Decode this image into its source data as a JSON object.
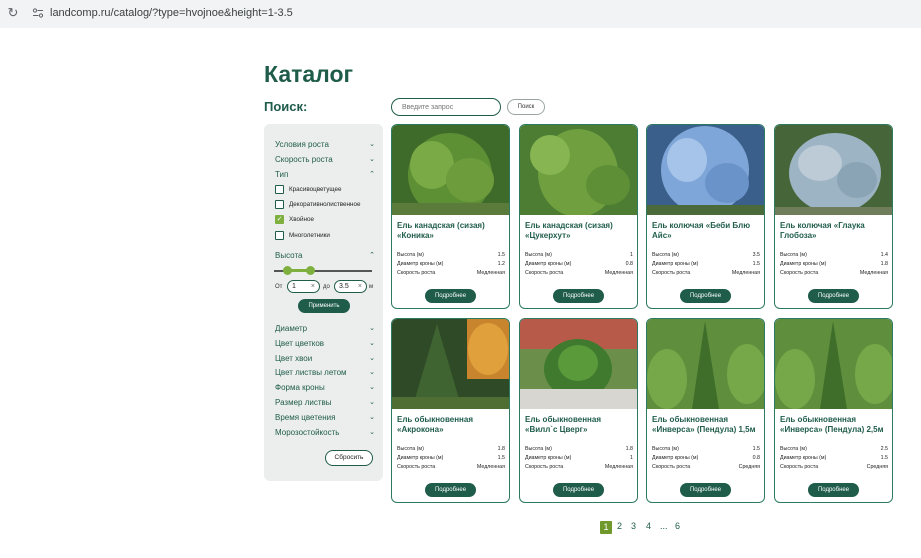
{
  "browser": {
    "url": "landcomp.ru/catalog/?type=hvojnoe&height=1-3.5"
  },
  "page": {
    "title": "Каталог"
  },
  "search": {
    "label": "Поиск:",
    "placeholder": "Введите запрос",
    "button": "Поиск"
  },
  "filters": {
    "growth_conditions": "Условия роста",
    "growth_speed": "Скорость роста",
    "type": "Тип",
    "type_options": [
      {
        "label": "Красивоцветущее",
        "checked": false
      },
      {
        "label": "Декоративнолиственное",
        "checked": false
      },
      {
        "label": "Хвойное",
        "checked": true
      },
      {
        "label": "Многолетники",
        "checked": false
      }
    ],
    "height": "Высота",
    "height_from_label": "От",
    "height_to_label": "до",
    "height_unit": "м",
    "height_from": "1",
    "height_to": "3.5",
    "apply": "Применить",
    "more": [
      "Диаметр",
      "Цвет цветков",
      "Цвет хвои",
      "Цвет листвы летом",
      "Форма кроны",
      "Размер листвы",
      "Время цветения",
      "Морозостойкость"
    ],
    "reset": "Сбросить"
  },
  "spec_labels": {
    "height": "Высота (м)",
    "diameter": "Диаметр кроны (м)",
    "speed": "Скорость роста"
  },
  "more_label": "Подробнее",
  "products": [
    {
      "name": "Ель канадская (сизая) «Коника»",
      "height": "1.5",
      "diameter": "1.2",
      "speed": "Медленная"
    },
    {
      "name": "Ель канадская (сизая) «Цукерхут»",
      "height": "1",
      "diameter": "0.8",
      "speed": "Медленная"
    },
    {
      "name": "Ель колючая «Беби Блю Айс»",
      "height": "3.5",
      "diameter": "1.5",
      "speed": "Медленная"
    },
    {
      "name": "Ель колючая «Глаука Глобоза»",
      "height": "1.4",
      "diameter": "1.8",
      "speed": "Медленная"
    },
    {
      "name": "Ель обыкновенная «Акрокона»",
      "height": "1.8",
      "diameter": "1.5",
      "speed": "Медленная"
    },
    {
      "name": "Ель обыкновенная «Вилл`с Цверг»",
      "height": "1.8",
      "diameter": "1",
      "speed": "Медленная"
    },
    {
      "name": "Ель обыкновенная «Инверса» (Пендула) 1,5м",
      "height": "1.5",
      "diameter": "0.8",
      "speed": "Средняя"
    },
    {
      "name": "Ель обыкновенная «Инверса» (Пендула) 2,5м",
      "height": "2.5",
      "diameter": "1.5",
      "speed": "Средняя"
    }
  ],
  "pagination": [
    "1",
    "2",
    "3",
    "4",
    "...",
    "6"
  ],
  "colors": {
    "brand": "#1f5c4a",
    "accent": "#7fb03f"
  }
}
